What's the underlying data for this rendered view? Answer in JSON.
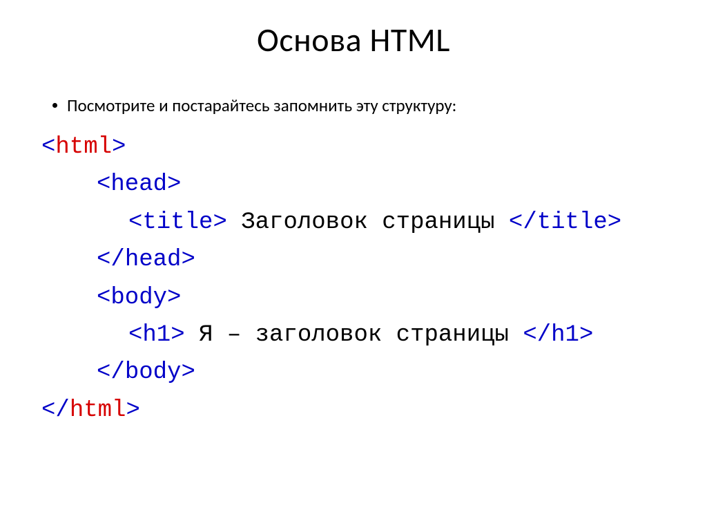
{
  "title": "Основа HTML",
  "bullet": "Посмотрите и постарайтесь запомнить эту структуру:",
  "code": {
    "lt": "<",
    "gt": ">",
    "slash": "/",
    "html": "html",
    "head": "head",
    "title_tag": "title",
    "body": "body",
    "h1": "h1",
    "title_text": " Заголовок страницы ",
    "h1_text": " Я – заголовок страницы "
  }
}
